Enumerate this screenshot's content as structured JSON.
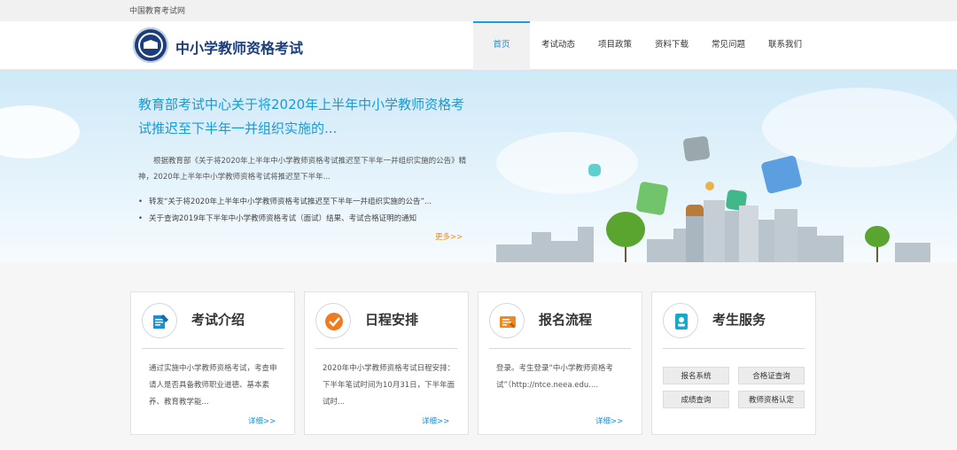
{
  "topbar": {
    "org_name": "中国教育考试网"
  },
  "header": {
    "site_title": "中小学教师资格考试",
    "nav": [
      {
        "label": "首页",
        "active": true
      },
      {
        "label": "考试动态",
        "active": false
      },
      {
        "label": "项目政策",
        "active": false
      },
      {
        "label": "资料下载",
        "active": false
      },
      {
        "label": "常见问题",
        "active": false
      },
      {
        "label": "联系我们",
        "active": false
      }
    ]
  },
  "hero": {
    "headline": "教育部考试中心关于将2020年上半年中小学教师资格考试推迟至下半年一并组织实施的...",
    "summary": "根据教育部《关于将2020年上半年中小学教师资格考试推迟至下半年一并组织实施的公告》精神，2020年上半年中小学教师资格考试将推迟至下半年...",
    "news": [
      "转发“关于将2020年上半年中小学教师资格考试推迟至下半年一并组织实施的公告”...",
      "关于查询2019年下半年中小学教师资格考试（面试）结果、考试合格证明的通知"
    ],
    "more_label": "更多>>"
  },
  "cards": [
    {
      "title": "考试介绍",
      "icon": "pencil-document-icon",
      "description": "通过实施中小学教师资格考试，考查申请人是否具备教师职业道德、基本素养、教育教学能...",
      "more_label": "详细>>"
    },
    {
      "title": "日程安排",
      "icon": "checkmark-icon",
      "description": "2020年中小学教师资格考试日程安排：下半年笔试时间为10月31日，下半年面试时...",
      "more_label": "详细>>"
    },
    {
      "title": "报名流程",
      "icon": "registration-form-icon",
      "description": "登录。考生登录“中小学教师资格考试”（http://ntce.neea.edu....",
      "more_label": "详细>>"
    },
    {
      "title": "考生服务",
      "icon": "id-card-icon",
      "services": [
        "报名系统",
        "合格证查询",
        "成绩查询",
        "教师资格认定"
      ]
    }
  ],
  "colors": {
    "brand_blue": "#1b3d7a",
    "accent_blue": "#1a9ad6",
    "more_orange": "#f08a1c",
    "icon_orange": "#f07a1f",
    "icon_blue": "#1a90d8"
  }
}
